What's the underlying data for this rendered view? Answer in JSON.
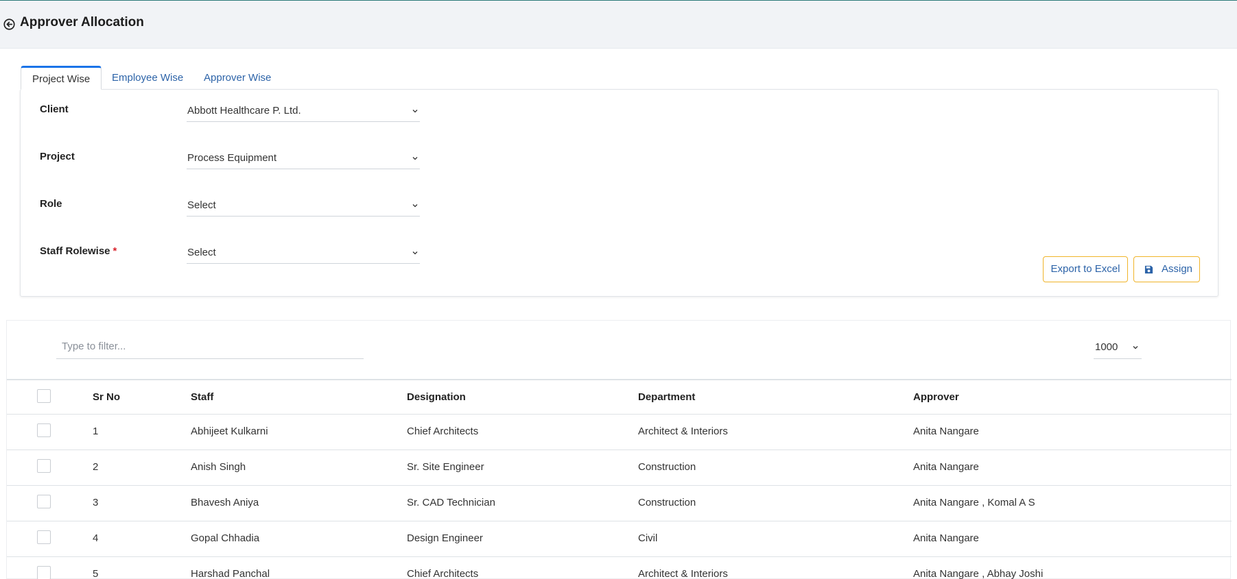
{
  "header": {
    "title": "Approver Allocation",
    "back_icon": "arrow-circle-left-icon"
  },
  "tabs": [
    {
      "label": "Project Wise",
      "active": true
    },
    {
      "label": "Employee Wise",
      "active": false
    },
    {
      "label": "Approver Wise",
      "active": false
    }
  ],
  "form": {
    "client": {
      "label": "Client",
      "value": "Abbott Healthcare P. Ltd."
    },
    "project": {
      "label": "Project",
      "value": "Process Equipment"
    },
    "role": {
      "label": "Role",
      "value": "Select"
    },
    "staff_rolewise": {
      "label": "Staff Rolewise",
      "required_mark": "*",
      "value": "Select"
    }
  },
  "buttons": {
    "export": "Export to Excel",
    "assign": "Assign",
    "assign_icon": "save-icon"
  },
  "table": {
    "filter_placeholder": "Type to filter...",
    "page_size": "1000",
    "columns": {
      "sr_no": "Sr No",
      "staff": "Staff",
      "designation": "Designation",
      "department": "Department",
      "approver": "Approver"
    },
    "rows": [
      {
        "sr_no": "1",
        "staff": "Abhijeet Kulkarni",
        "designation": "Chief Architects",
        "department": "Architect & Interiors",
        "approver": "Anita Nangare"
      },
      {
        "sr_no": "2",
        "staff": "Anish Singh",
        "designation": "Sr. Site Engineer",
        "department": "Construction",
        "approver": "Anita Nangare"
      },
      {
        "sr_no": "3",
        "staff": "Bhavesh Aniya",
        "designation": "Sr. CAD Technician",
        "department": "Construction",
        "approver": "Anita Nangare , Komal A S"
      },
      {
        "sr_no": "4",
        "staff": "Gopal Chhadia",
        "designation": "Design Engineer",
        "department": "Civil",
        "approver": "Anita Nangare"
      },
      {
        "sr_no": "5",
        "staff": "Harshad Panchal",
        "designation": "Chief Architects",
        "department": "Architect & Interiors",
        "approver": "Anita Nangare , Abhay Joshi"
      }
    ]
  },
  "colors": {
    "tab_accent": "#1a73e8",
    "link_blue": "#2c63a8",
    "button_border": "#f0b429",
    "required": "#d9232d",
    "header_bg": "#f1f3f6"
  }
}
